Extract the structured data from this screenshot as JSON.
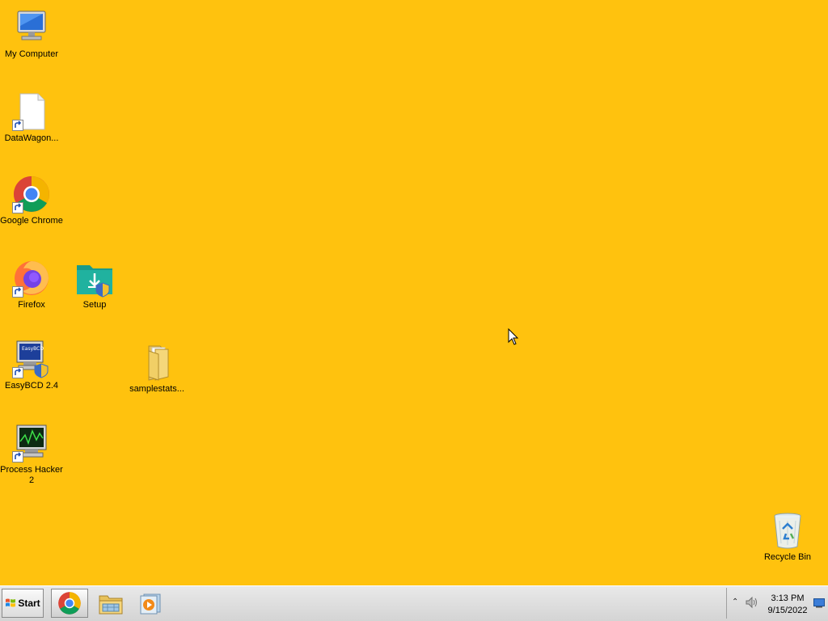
{
  "desktop": {
    "background_color": "#FFC20E",
    "icons": [
      {
        "label": "My Computer",
        "icon": "computer-icon"
      },
      {
        "label": "DataWagon...",
        "icon": "document-shortcut-icon"
      },
      {
        "label": "Google Chrome",
        "icon": "chrome-icon"
      },
      {
        "label": "Firefox",
        "icon": "firefox-icon"
      },
      {
        "label": "Setup",
        "icon": "setup-folder-icon"
      },
      {
        "label": "EasyBCD 2.4",
        "icon": "easybcd-icon"
      },
      {
        "label": "samplestats...",
        "icon": "folder-icon"
      },
      {
        "label": "Process Hacker 2",
        "icon": "process-hacker-icon"
      },
      {
        "label": "Recycle Bin",
        "icon": "recycle-bin-icon"
      }
    ]
  },
  "taskbar": {
    "start_label": "Start",
    "pinned": [
      {
        "name": "Google Chrome",
        "icon": "chrome-icon",
        "active": true
      },
      {
        "name": "Windows Explorer",
        "icon": "explorer-icon",
        "active": false
      },
      {
        "name": "Media Player",
        "icon": "media-player-icon",
        "active": false
      }
    ],
    "tray": {
      "show_hidden_glyph": "⌃",
      "time": "3:13 PM",
      "date": "9/15/2022"
    }
  }
}
